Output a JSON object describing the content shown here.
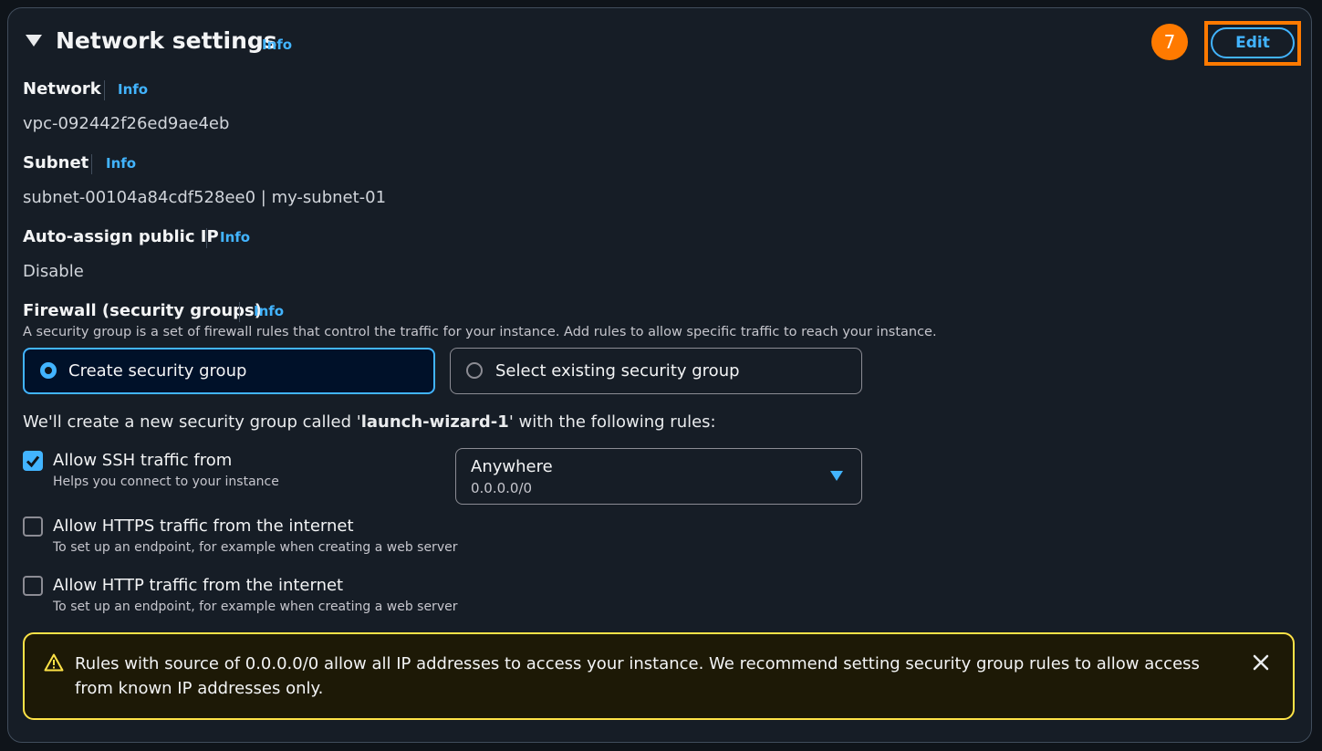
{
  "header": {
    "title": "Network settings",
    "info": "Info",
    "step_badge": "7",
    "edit_label": "Edit"
  },
  "network": {
    "label": "Network",
    "info": "Info",
    "value": "vpc-092442f26ed9ae4eb"
  },
  "subnet": {
    "label": "Subnet",
    "info": "Info",
    "value": "subnet-00104a84cdf528ee0 | my-subnet-01"
  },
  "auto_ip": {
    "label": "Auto-assign public IP",
    "info": "Info",
    "value": "Disable"
  },
  "firewall": {
    "label": "Firewall (security groups)",
    "info": "Info",
    "description": "A security group is a set of firewall rules that control the traffic for your instance. Add rules to allow specific traffic to reach your instance.",
    "options": [
      {
        "label": "Create security group",
        "selected": true
      },
      {
        "label": "Select existing security group",
        "selected": false
      }
    ],
    "summary_prefix": "We'll create a new security group called '",
    "group_name": "launch-wizard-1",
    "summary_suffix": "' with the following rules:"
  },
  "rules": {
    "ssh": {
      "label": "Allow SSH traffic from",
      "description": "Helps you connect to your instance",
      "checked": true
    },
    "https": {
      "label": "Allow HTTPS traffic from the internet",
      "description": "To set up an endpoint, for example when creating a web server",
      "checked": false
    },
    "http": {
      "label": "Allow HTTP traffic from the internet",
      "description": "To set up an endpoint, for example when creating a web server",
      "checked": false
    }
  },
  "source_select": {
    "value": "Anywhere",
    "sub": "0.0.0.0/0"
  },
  "alert": {
    "text": "Rules with source of 0.0.0.0/0 allow all IP addresses to access your instance. We recommend setting security group rules to allow access from known IP addresses only."
  },
  "colors": {
    "accent": "#42b4ff",
    "highlight": "#ff7a00",
    "warning": "#ffe347",
    "background": "#161d26"
  }
}
